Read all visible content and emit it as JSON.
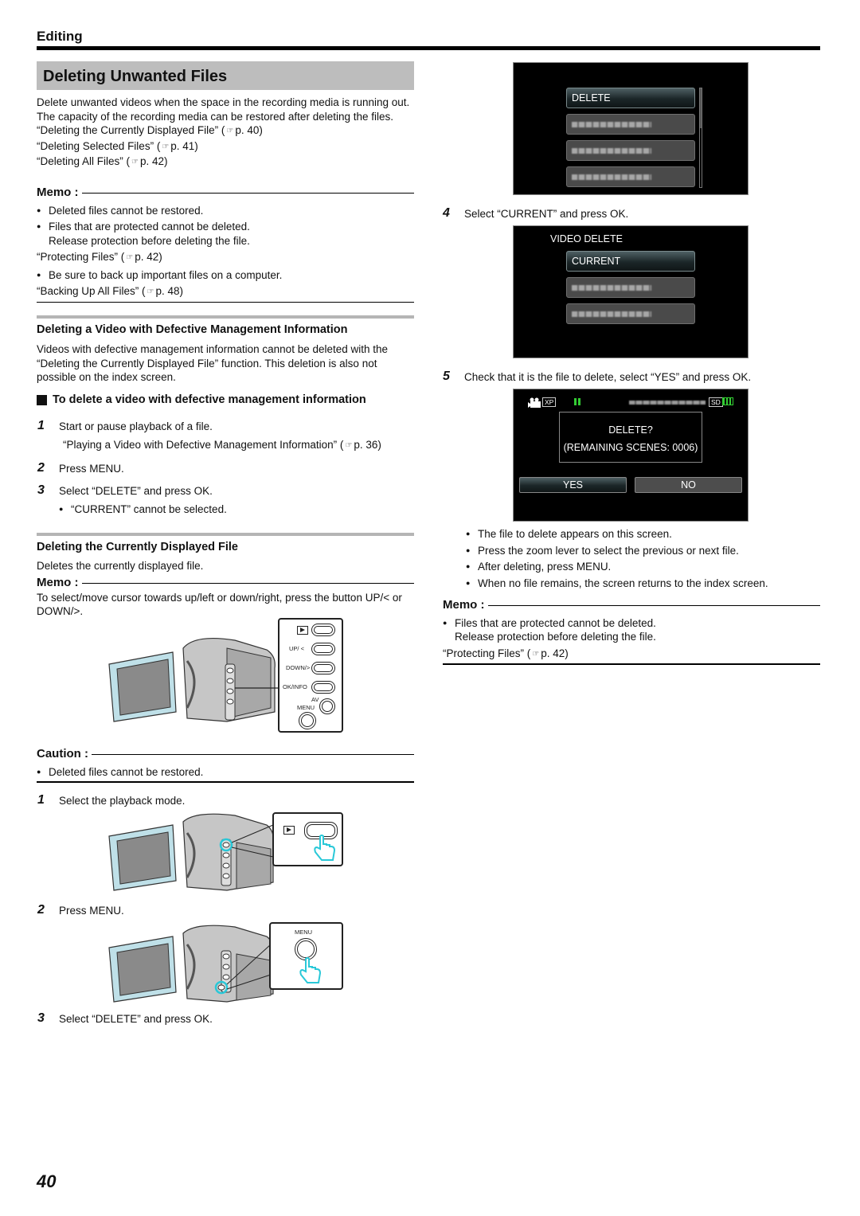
{
  "header": {
    "section": "Editing"
  },
  "title": "Deleting Unwanted Files",
  "intro": {
    "lines": [
      "Delete unwanted videos when the space in the recording media is running out.",
      "The capacity of the recording media can be restored after deleting the files."
    ],
    "refs": [
      {
        "text": "“Deleting the Currently Displayed File” (",
        "page": "p. 40)"
      },
      {
        "text": "“Deleting Selected Files” (",
        "page": "p. 41)"
      },
      {
        "text": "“Deleting All Files” (",
        "page": "p. 42)"
      }
    ]
  },
  "memo1": {
    "heading": "Memo :",
    "bullet1": "Deleted files cannot be restored.",
    "bullet2a": "Files that are protected cannot be deleted.",
    "bullet2b": "Release protection before deleting the file.",
    "ref1": {
      "text": "“Protecting Files” (",
      "page": "p. 42)"
    },
    "bullet3": "Be sure to back up important files on a computer.",
    "ref2": {
      "text": "“Backing Up All Files” (",
      "page": "p. 48)"
    }
  },
  "defective": {
    "heading": "Deleting a Video with Defective Management Information",
    "body": "Videos with defective management information cannot be deleted with the “Deleting the Currently Displayed File” function. This deletion is also not possible on the index screen.",
    "subheading": "To delete a video with defective management information",
    "steps": [
      {
        "num": "1",
        "text": "Start or pause playback of a file."
      },
      {
        "num": "2",
        "text": "Press MENU."
      },
      {
        "num": "3",
        "text": "Select “DELETE” and press OK."
      }
    ],
    "step1_ref": {
      "text": "“Playing a Video with Defective Management Information” (",
      "page": "p. 36)"
    },
    "step3_note": "“CURRENT” cannot be selected."
  },
  "current_file": {
    "heading": "Deleting the Currently Displayed File",
    "body": "Deletes the currently displayed file.",
    "memo_heading": "Memo :",
    "memo_text": "To select/move cursor towards up/left or down/right, press the button UP/< or DOWN/>.",
    "panel_labels": {
      "up": "UP/ <",
      "down": "DOWN/>",
      "ok": "OK/INFO",
      "av": "AV",
      "menu": "MENU"
    },
    "caution_heading": "Caution :",
    "caution_bullet": "Deleted files cannot be restored.",
    "steps": [
      {
        "num": "1",
        "text": "Select the playback mode."
      },
      {
        "num": "2",
        "text": "Press MENU."
      },
      {
        "num": "3",
        "text": "Select “DELETE” and press OK."
      },
      {
        "num": "4",
        "text": "Select “CURRENT” and press OK."
      },
      {
        "num": "5",
        "text": "Check that it is the file to delete, select “YES” and press OK."
      }
    ],
    "menu_label": "MENU"
  },
  "screen1": {
    "selected": "DELETE"
  },
  "screen2": {
    "title": "VIDEO DELETE",
    "selected": "CURRENT"
  },
  "screen3": {
    "mode": "XP",
    "media": "SD",
    "question": "DELETE?",
    "remaining": "(REMAINING SCENES: 0006)",
    "yes": "YES",
    "no": "NO",
    "colors": {
      "pause": "#33cc33",
      "battery": "#33cc33"
    }
  },
  "step5_notes": [
    "The file to delete appears on this screen.",
    "Press the zoom lever to select the previous or next file.",
    "After deleting, press MENU.",
    "When no file remains, the screen returns to the index screen."
  ],
  "memo2": {
    "heading": "Memo :",
    "bullet_a": "Files that are protected cannot be deleted.",
    "bullet_b": "Release protection before deleting the file.",
    "ref": {
      "text": "“Protecting Files” (",
      "page": "p. 42)"
    }
  },
  "page_number": "40",
  "accent": {
    "highlight": "#29c8d8"
  }
}
